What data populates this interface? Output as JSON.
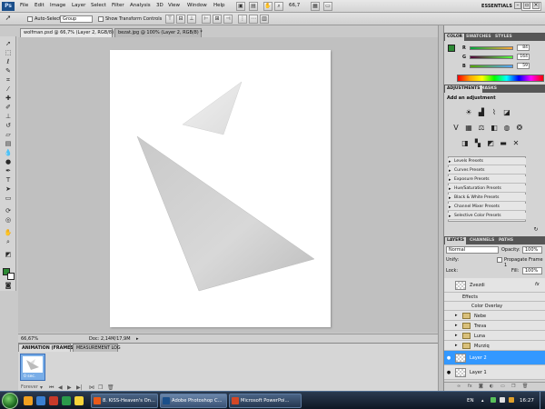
{
  "app": {
    "logo": "Ps"
  },
  "menus": [
    "File",
    "Edit",
    "Image",
    "Layer",
    "Select",
    "Filter",
    "Analysis",
    "3D",
    "View",
    "Window",
    "Help"
  ],
  "toolbar": {
    "zoom": "66,7",
    "workspace": "ESSENTIALS"
  },
  "options": {
    "auto_select_label": "Auto-Select:",
    "auto_select_value": "Group",
    "show_transform_label": "Show Transform Controls"
  },
  "documents": [
    {
      "label": "wolfman.psd @ 66,7% (Layer 2, RGB/8) *",
      "active": true
    },
    {
      "label": "bezat.jpg @ 100% (Layer 2, RGB/8) *",
      "active": false
    }
  ],
  "status": {
    "zoom": "66,67%",
    "doc": "Doc: 2,14M/17,9M"
  },
  "animation": {
    "tabs": [
      "ANIMATION (FRAMES)",
      "MEASUREMENT LOG"
    ],
    "frame_delay": "0 sec.",
    "loop": "Forever"
  },
  "color_panel": {
    "tabs": [
      "COLOR",
      "SWATCHES",
      "STYLES"
    ],
    "channels": [
      {
        "label": "R",
        "value": "84"
      },
      {
        "label": "G",
        "value": "164"
      },
      {
        "label": "B",
        "value": "59"
      }
    ]
  },
  "adjustments": {
    "tabs": [
      "ADJUSTMENTS",
      "MASKS"
    ],
    "heading": "Add an adjustment",
    "presets": [
      "Levels Presets",
      "Curves Presets",
      "Exposure Presets",
      "Hue/Saturation Presets",
      "Black & White Presets",
      "Channel Mixer Presets",
      "Selective Color Presets"
    ]
  },
  "layers": {
    "tabs": [
      "LAYERS",
      "CHANNELS",
      "PATHS"
    ],
    "blend_mode": "Normal",
    "opacity_label": "Opacity:",
    "opacity": "100%",
    "unify_label": "Unify:",
    "propagate_label": "Propagate Frame 1",
    "lock_label": "Lock:",
    "fill_label": "Fill:",
    "fill": "100%",
    "items": {
      "zvezdi": "Zvezdi",
      "effects": "Effects",
      "color_overlay": "Color Overlay",
      "nebe": "Nebe",
      "treva": "Treva",
      "luna": "Luna",
      "murziq": "Murziq",
      "layer2": "Layer 2",
      "layer1": "Layer 1"
    }
  },
  "taskbar": {
    "tasks": [
      "8. KISS-Heaven's On...",
      "Adobe Photoshop C...",
      "Microsoft PowerPoi..."
    ],
    "lang": "EN",
    "clock": "16:27"
  },
  "colors": {
    "foreground": "#2d8a35",
    "selection": "#3398ff"
  }
}
